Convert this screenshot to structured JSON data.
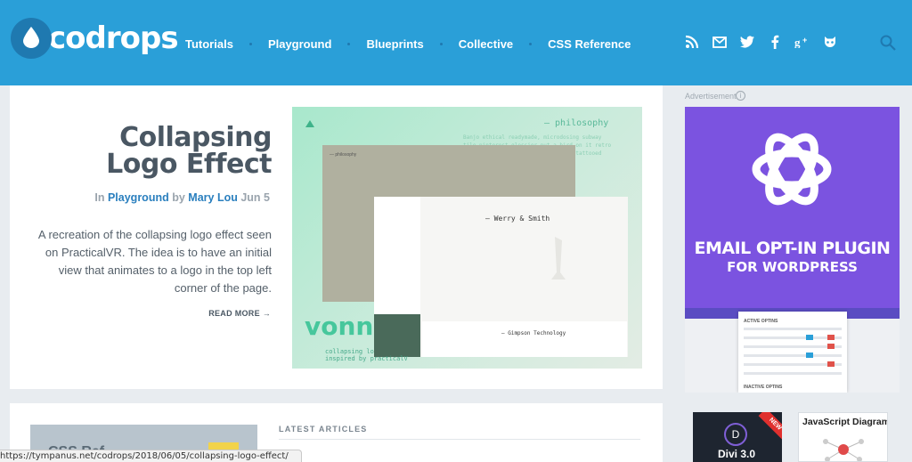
{
  "header": {
    "logo_text": "codrops",
    "nav": [
      "Tutorials",
      "Playground",
      "Blueprints",
      "Collective",
      "CSS Reference"
    ],
    "social_icons": [
      "rss-icon",
      "mail-icon",
      "twitter-icon",
      "facebook-icon",
      "google-plus-icon",
      "github-icon"
    ],
    "social_glyphs": [
      "◉",
      "✉",
      "🐦",
      "f",
      "g+",
      "🐱"
    ],
    "search_icon": "search-icon",
    "colors": {
      "bar": "#2a9fd8",
      "logo_circle": "#1f79b0"
    }
  },
  "article": {
    "title": "Collapsing Logo Effect",
    "meta_in": "In",
    "meta_category": "Playground",
    "meta_by": "by",
    "meta_author": "Mary Lou",
    "meta_date": "Jun 5",
    "description": "A recreation of the collapsing logo effect seen on PracticalVR. The idea is to have an initial view that animates to a logo in the top left corner of the page.",
    "read_more": "READ MORE →"
  },
  "feature_image": {
    "philosophy": "— philosophy",
    "philosophy_text": "Banjo ethical readymade, microdosing subway tile pinterest glossier put a bird on it retro direct trade brooklyn portland DIY tattooed vaporware master",
    "grey_text": "— philosophy",
    "werry": "— Werry & Smith",
    "gimpson": "— Gimpson Technology",
    "vonn": "vonn",
    "collapsing": "collapsing lo\ninspired by practicalV"
  },
  "sidebar": {
    "ad_label": "Advertisement",
    "ad_info": "i",
    "ad_title": "EMAIL OPT-IN PLUGIN",
    "ad_subtitle": "FOR WORDPRESS",
    "ad_panel_label": "ACTIVE OPTINS",
    "ad_panel_label2": "INACTIVE OPTINS",
    "ad_color": "#7b53e0"
  },
  "latest": {
    "heading": "LATEST ARTICLES",
    "thumb_text": "CSS Ref"
  },
  "ads_bottom": {
    "divi_title": "Divi 3.0",
    "divi_letter": "D",
    "divi_badge": "NEW",
    "js_title": "JavaScript Diagrams"
  },
  "status_bar": {
    "url": "https://tympanus.net/codrops/2018/06/05/collapsing-logo-effect/"
  }
}
